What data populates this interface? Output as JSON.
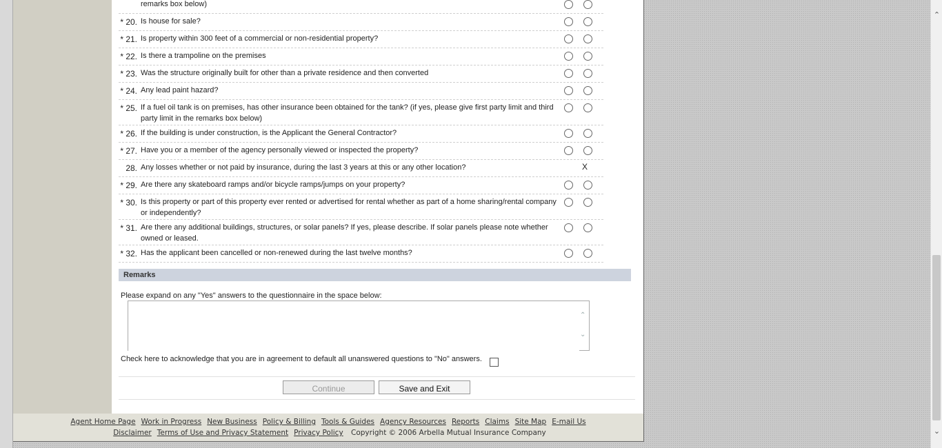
{
  "questions": [
    {
      "num": "",
      "required": false,
      "lines": 1,
      "text": "remarks box below)",
      "answer": "radio"
    },
    {
      "num": "20.",
      "required": true,
      "lines": 1,
      "text": "Is house for sale?",
      "answer": "radio"
    },
    {
      "num": "21.",
      "required": true,
      "lines": 1,
      "text": "Is property within 300 feet of a commercial or non-residential property?",
      "answer": "radio"
    },
    {
      "num": "22.",
      "required": true,
      "lines": 1,
      "text": "Is there a trampoline on the premises",
      "answer": "radio"
    },
    {
      "num": "23.",
      "required": true,
      "lines": 1,
      "text": "Was the structure originally built for other than a private residence and then converted",
      "answer": "radio"
    },
    {
      "num": "24.",
      "required": true,
      "lines": 1,
      "text": "Any lead paint hazard?",
      "answer": "radio"
    },
    {
      "num": "25.",
      "required": true,
      "lines": 2,
      "text": "If a fuel oil tank is on premises, has other insurance been obtained for the tank? (if yes, please give first party limit and third party limit in the remarks box below)",
      "answer": "radio"
    },
    {
      "num": "26.",
      "required": true,
      "lines": 1,
      "text": "If the building is under construction, is the Applicant the General Contractor?",
      "answer": "radio"
    },
    {
      "num": "27.",
      "required": true,
      "lines": 1,
      "text": "Have you or a member of the agency personally viewed or inspected the property?",
      "answer": "radio"
    },
    {
      "num": "28.",
      "required": false,
      "lines": 1,
      "text": "Any losses whether or not paid by insurance, during the last 3 years at this or any other location?",
      "answer": "X"
    },
    {
      "num": "29.",
      "required": true,
      "lines": 1,
      "text": "Are there any skateboard ramps and/or bicycle ramps/jumps on your property?",
      "answer": "radio"
    },
    {
      "num": "30.",
      "required": true,
      "lines": 2,
      "text": "Is this property or part of this property ever rented or advertised for rental whether as part of a home sharing/rental company or independently?",
      "answer": "radio"
    },
    {
      "num": "31.",
      "required": true,
      "lines": 2,
      "text": "Are there any additional buildings, structures, or solar panels? If yes, please describe. If solar panels please note whether owned or leased.",
      "answer": "radio"
    },
    {
      "num": "32.",
      "required": true,
      "lines": 1,
      "text": "Has the applicant been cancelled or non-renewed during the last twelve months?",
      "answer": "radio"
    }
  ],
  "remarks": {
    "header": "Remarks",
    "prompt": "Please expand on any \"Yes\" answers to the questionnaire in the space below:",
    "value": ""
  },
  "acknowledge": {
    "label": "Check here to acknowledge that you are in agreement to default all unanswered questions to \"No\" answers."
  },
  "buttons": {
    "continue_label": "Continue",
    "save_exit_label": "Save and Exit"
  },
  "footer": {
    "links_row1": [
      "Agent Home Page",
      "Work in Progress",
      "New Business",
      "Policy & Billing",
      "Tools & Guides",
      "Agency Resources",
      "Reports",
      "Claims",
      "Site Map",
      "E-mail Us"
    ],
    "links_row2": [
      "Disclaimer",
      "Terms of Use and Privacy Statement",
      "Privacy Policy"
    ],
    "copyright": "Copyright © 2006 Arbella Mutual Insurance Company"
  }
}
